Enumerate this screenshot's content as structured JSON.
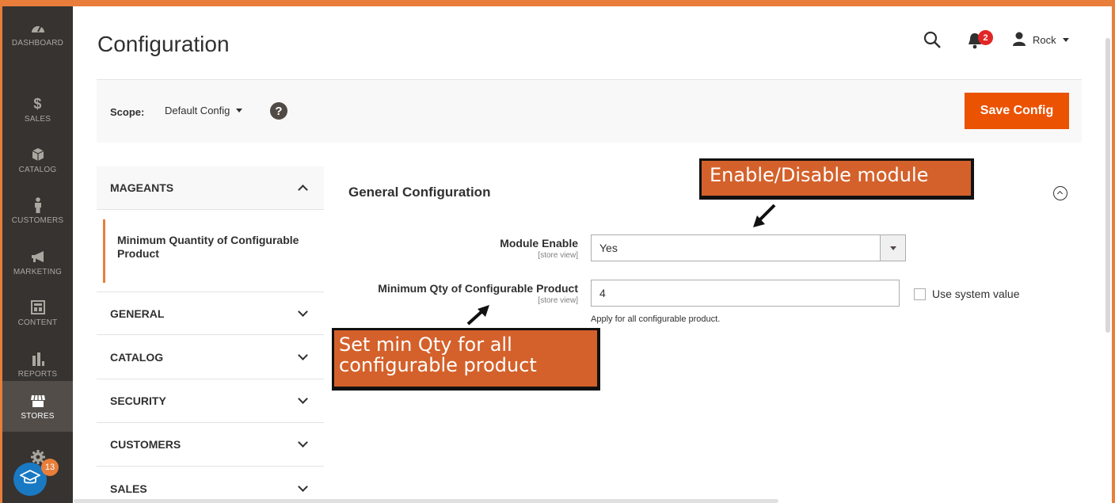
{
  "menu": {
    "items": [
      {
        "label": "DASHBOARD",
        "icon": "dashboard-gauge-icon"
      },
      {
        "label": "SALES",
        "icon": "dollar-icon"
      },
      {
        "label": "CATALOG",
        "icon": "box-icon"
      },
      {
        "label": "CUSTOMERS",
        "icon": "person-icon"
      },
      {
        "label": "MARKETING",
        "icon": "megaphone-icon"
      },
      {
        "label": "CONTENT",
        "icon": "layout-icon"
      },
      {
        "label": "REPORTS",
        "icon": "bar-chart-icon"
      },
      {
        "label": "STORES",
        "icon": "store-icon"
      },
      {
        "label": "",
        "icon": "gear-icon"
      }
    ],
    "active": "STORES",
    "academy_badge": "13"
  },
  "header": {
    "title": "Configuration",
    "notifications_count": "2",
    "user_name": "Rock"
  },
  "scope": {
    "label": "Scope:",
    "value": "Default Config",
    "help": "?",
    "save_label": "Save Config"
  },
  "tabs": {
    "mageants": {
      "label": "MAGEANTS",
      "sub_item": "Minimum Quantity of Configurable Product"
    },
    "sections": [
      "GENERAL",
      "CATALOG",
      "SECURITY",
      "CUSTOMERS",
      "SALES"
    ]
  },
  "main": {
    "section_title": "General Configuration",
    "fields": {
      "module_enable": {
        "label": "Module Enable",
        "scope": "[store view]",
        "value": "Yes"
      },
      "min_qty": {
        "label": "Minimum Qty of Configurable Product",
        "scope": "[store view]",
        "value": "4",
        "note": "Apply for all configurable product.",
        "use_system": "Use system value"
      }
    }
  },
  "annotations": {
    "enable": "Enable/Disable module",
    "min_qty_line1": "Set min Qty for all",
    "min_qty_line2": "configurable product"
  },
  "colors": {
    "accent": "#eb5202",
    "frame": "#e87e3a",
    "menu_bg": "#373330",
    "callout": "#d4612b"
  }
}
